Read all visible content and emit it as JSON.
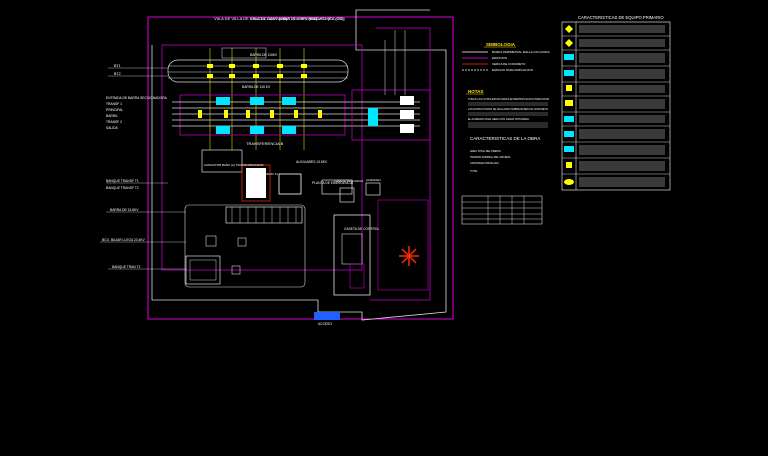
{
  "roads": {
    "villa": "VIA A DE VILLA DE GRACIA 115KV (CC)",
    "santa": "VIA A DE SANTA MARTA 115KV (CC)",
    "esperanza": "VIA A DE ESPERANZA 115KV (CC)",
    "futuro": "FUTURO (CC-ORI)"
  },
  "left_labels": [
    "BT1",
    "BT2",
    "ENTRADA DE BARRA SECCIONADORA",
    "TRANSF 1",
    "PRINCIPAL",
    "BARRA",
    "TRANSF 2",
    "SALIDA",
    "BANQUE TRANSF T1",
    "BANQUE TRANSF T2",
    "BARRA DE 13.8KV",
    "BCO. BAJAR LLEGA 23.4KV",
    "BANQUE TRAN T2"
  ],
  "diagram_labels": {
    "barra": "BARRA DE 115KV",
    "barra_alt": "BARRA DE 115 KV",
    "transfer": "TRANSFERENCIA B",
    "capacitor": "CAPACITOR BANK (A) TRANSFORMADOR",
    "transformer": "TRANSFORMADOR T1",
    "aux": "AUXILIARES 13.8KV",
    "planta": "PLANTA DE EMERGENCIA",
    "caseta_vig": "CASETA VIGILANCIA",
    "almacen": "ALMACEN",
    "caseta_ctrl": "CASETA DE CONTROL",
    "acceso": "ACCESO"
  },
  "legend": {
    "title": "SIMBOLOGIA",
    "items": [
      "BARDA PERIMETRAL MALLA CICLONICA",
      "EDIFICIOS",
      "CERCA DE CONCRETO",
      "ESPACIO PARA AMPLIACION"
    ]
  },
  "notes": {
    "title": "NOTAS",
    "items": [
      "TODAS LAS COTAS ESTAN DADAS EN METROS SALVO INDICACION",
      "LAS ESTRUCTURAS SE ANCLARAN SOBRE BASES DE CONCRETO",
      "EL ACABADO FINAL SERA CON GRAVA TRITURADA"
    ]
  },
  "obra": {
    "title": "CARACTERISTICAS DE LA OBRA",
    "items": [
      "AREA TOTAL DEL PREDIO",
      "TENSION NOMINAL DEL SISTEMA",
      "CAPACIDAD INSTALADA"
    ],
    "total_label": "TOTAL"
  },
  "equipment": {
    "title": "CARACTERISTICAS DE EQUIPO PRIMARIO"
  },
  "colors": {
    "background": "#000000",
    "boundary": "#ff00ff",
    "buses": "#ffffff",
    "equipment": "#00e5ff",
    "insulators": "#ffff00",
    "alarm": "#ff2a00"
  }
}
